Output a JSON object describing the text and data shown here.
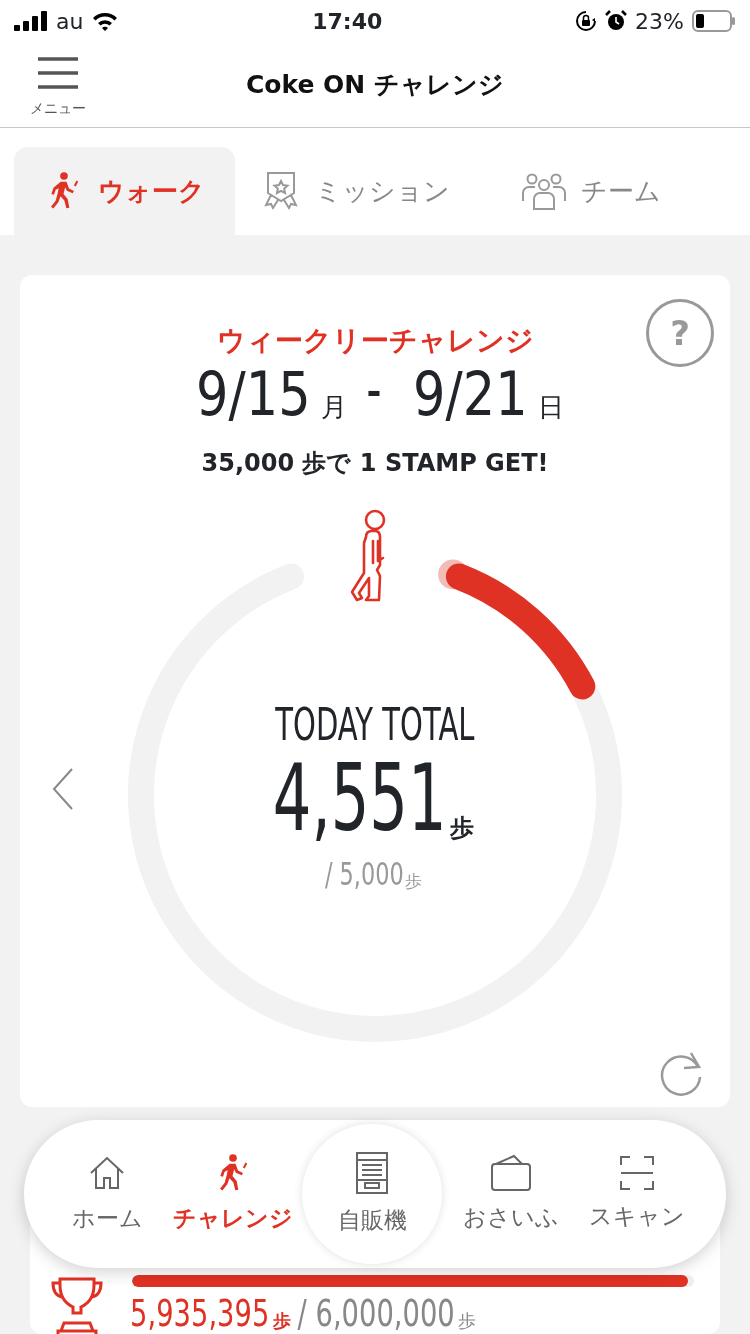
{
  "status_bar": {
    "carrier": "au",
    "time": "17:40",
    "battery": "23%"
  },
  "header": {
    "menu_label": "メニュー",
    "title": "Coke ON チャレンジ"
  },
  "tabs": [
    {
      "label": "ウォーク",
      "kind": "walk",
      "selected": true
    },
    {
      "label": "ミッション",
      "kind": "mission",
      "selected": false
    },
    {
      "label": "チーム",
      "kind": "team",
      "selected": false
    }
  ],
  "challenge": {
    "help": "?",
    "title": "ウィークリーチャレンジ",
    "start_date": "9/15",
    "start_day": "月",
    "separator": "-",
    "end_date": "9/21",
    "end_day": "日",
    "goal": "35,000",
    "goal_unit": "歩で",
    "goal_text": "1 STAMP GET!",
    "today_label": "TODAY TOTAL",
    "today_steps": "4,551",
    "today_unit": "歩",
    "target": "/ 5,000",
    "target_unit": "歩"
  },
  "nav": [
    {
      "label": "ホーム",
      "kind": "home",
      "selected": false
    },
    {
      "label": "チャレンジ",
      "kind": "walk",
      "selected": true
    },
    {
      "label": "自販機",
      "kind": "vending",
      "selected": false
    },
    {
      "label": "おさいふ",
      "kind": "wallet",
      "selected": false
    },
    {
      "label": "スキャン",
      "kind": "scan",
      "selected": false
    }
  ],
  "team_progress": {
    "steps": "5,935,395",
    "steps_unit": "歩",
    "target": "/ 6,000,000",
    "target_unit": "歩",
    "level": 0.99
  }
}
